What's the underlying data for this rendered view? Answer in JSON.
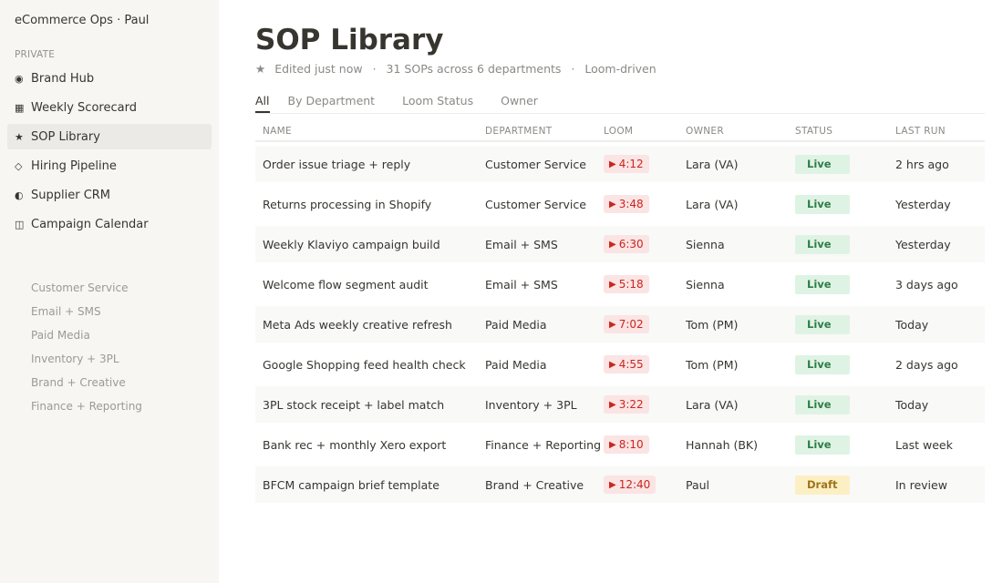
{
  "sidebar": {
    "workspace": "eCommerce Ops · Paul",
    "section_label": "PRIVATE",
    "items": [
      {
        "icon": "◉",
        "icon_name": "target-icon",
        "label": "Brand Hub"
      },
      {
        "icon": "▦",
        "icon_name": "grid-icon",
        "label": "Weekly Scorecard"
      },
      {
        "icon": "★",
        "icon_name": "star-icon",
        "label": "SOP Library",
        "active": true
      },
      {
        "icon": "◇",
        "icon_name": "diamond-icon",
        "label": "Hiring Pipeline"
      },
      {
        "icon": "◐",
        "icon_name": "half-circle-icon",
        "label": "Supplier CRM"
      },
      {
        "icon": "◫",
        "icon_name": "calendar-icon",
        "label": "Campaign Calendar"
      }
    ],
    "sub_items": [
      "Customer Service",
      "Email + SMS",
      "Paid Media",
      "Inventory + 3PL",
      "Brand + Creative",
      "Finance + Reporting"
    ]
  },
  "page": {
    "title": "SOP Library",
    "meta_star": "★",
    "meta_edited": "Edited just now",
    "meta_sep": "·",
    "meta_count": "31 SOPs across 6 departments",
    "meta_tag": "Loom-driven"
  },
  "tabs": [
    "All",
    "By Department",
    "Loom Status",
    "Owner"
  ],
  "table": {
    "headers": {
      "name": "NAME",
      "department": "DEPARTMENT",
      "loom": "LOOM",
      "owner": "OWNER",
      "status": "STATUS",
      "last_run": "LAST RUN"
    },
    "play_glyph": "▶",
    "rows": [
      {
        "name": "Order issue triage + reply",
        "department": "Customer Service",
        "loom": "4:12",
        "owner": "Lara (VA)",
        "status": "Live",
        "last_run": "2 hrs ago"
      },
      {
        "name": "Returns processing in Shopify",
        "department": "Customer Service",
        "loom": "3:48",
        "owner": "Lara (VA)",
        "status": "Live",
        "last_run": "Yesterday"
      },
      {
        "name": "Weekly Klaviyo campaign build",
        "department": "Email + SMS",
        "loom": "6:30",
        "owner": "Sienna",
        "status": "Live",
        "last_run": "Yesterday"
      },
      {
        "name": "Welcome flow segment audit",
        "department": "Email + SMS",
        "loom": "5:18",
        "owner": "Sienna",
        "status": "Live",
        "last_run": "3 days ago"
      },
      {
        "name": "Meta Ads weekly creative refresh",
        "department": "Paid Media",
        "loom": "7:02",
        "owner": "Tom (PM)",
        "status": "Live",
        "last_run": "Today"
      },
      {
        "name": "Google Shopping feed health check",
        "department": "Paid Media",
        "loom": "4:55",
        "owner": "Tom (PM)",
        "status": "Live",
        "last_run": "2 days ago"
      },
      {
        "name": "3PL stock receipt + label match",
        "department": "Inventory + 3PL",
        "loom": "3:22",
        "owner": "Lara (VA)",
        "status": "Live",
        "last_run": "Today"
      },
      {
        "name": "Bank rec + monthly Xero export",
        "department": "Finance + Reporting",
        "loom": "8:10",
        "owner": "Hannah (BK)",
        "status": "Live",
        "last_run": "Last week"
      },
      {
        "name": "BFCM campaign brief template",
        "department": "Brand + Creative",
        "loom": "12:40",
        "owner": "Paul",
        "status": "Draft",
        "last_run": "In review"
      }
    ]
  }
}
